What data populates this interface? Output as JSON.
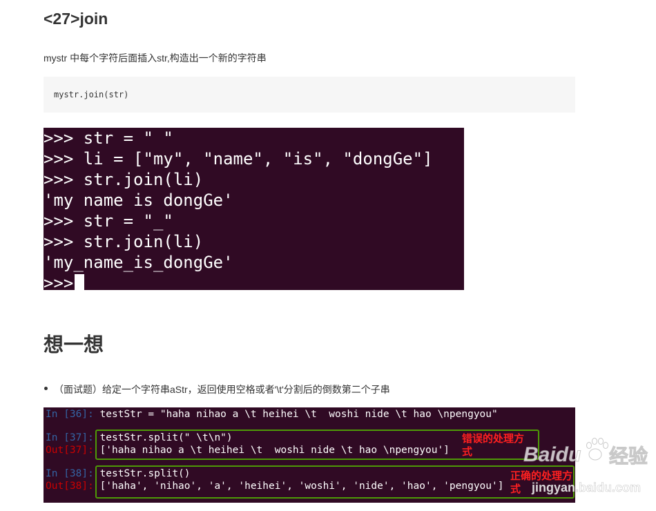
{
  "section27": {
    "heading": "<27>join",
    "description": "mystr 中每个字符后面插入str,构造出一个新的字符串",
    "code": "mystr.join(str)"
  },
  "terminal1": {
    "lines": [
      ">>> str = \" \"",
      ">>> li = [\"my\", \"name\", \"is\", \"dongGe\"]",
      ">>> str.join(li)",
      "'my name is dongGe'",
      ">>> str = \"_\"",
      ">>> str.join(li)",
      "'my_name_is_dongGe'",
      ">>>"
    ]
  },
  "think": {
    "heading": "想一想",
    "bullet": "（面试题）给定一个字符串aStr，返回使用空格或者'\\t'分割后的倒数第二个子串"
  },
  "terminal2": {
    "in36_prompt": "In [36]:",
    "in36_code": " testStr = \"haha nihao a \\t heihei \\t  woshi nide \\t hao \\npengyou\"",
    "in37_prompt": "In [37]:",
    "in37_code": " testStr.split(\" \\t\\n\")",
    "out37_prompt": "Out[37]:",
    "out37_value": " ['haha nihao a \\t heihei \\t  woshi nide \\t hao \\npengyou']",
    "in38_prompt": "In [38]:",
    "in38_code": " testStr.split()",
    "out38_prompt": "Out[38]:",
    "out38_value": " ['haha', 'nihao', 'a', 'heihei', 'woshi', 'nide', 'hao', 'pengyou']",
    "annotation_wrong_1": "错误的处理方",
    "annotation_wrong_2": "式",
    "annotation_right_1": "正确的处理方",
    "annotation_right_2": "式"
  },
  "watermark": {
    "brand": "Baidu",
    "cn": "经验",
    "url": "jingyan.baidu.com"
  }
}
